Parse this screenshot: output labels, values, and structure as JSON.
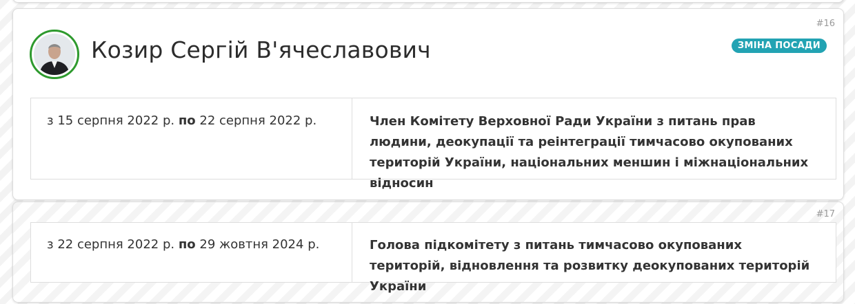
{
  "person": {
    "name": "Козир Сергій В'ячеславович"
  },
  "entries": [
    {
      "number": "#16",
      "badge": "ЗМІНА ПОСАДИ",
      "from_word": "з",
      "from_date": "15 серпня 2022 р.",
      "to_word": "по",
      "to_date": "22 серпня 2022 р.",
      "role": "Член Комітету Верховної Ради України з питань прав людини, деокупації та реінтеграції тимчасово окупованих територій України, національних меншин і міжнаціональних відносин"
    },
    {
      "number": "#17",
      "from_word": "з",
      "from_date": "22 серпня 2022 р.",
      "to_word": "по",
      "to_date": "29 жовтня 2024 р.",
      "role": "Голова підкомітету з питань тимчасово окупованих територій, відновлення та розвитку деокупованих територій України"
    }
  ],
  "colors": {
    "badge_bg": "#22a3b3",
    "avatar_ring": "#2e9a2e",
    "text": "#333333"
  }
}
